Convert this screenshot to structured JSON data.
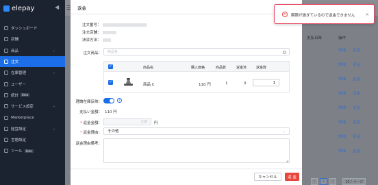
{
  "app": {
    "brand": "elepay"
  },
  "sidebar": {
    "items": [
      {
        "label": "ダッシュボード",
        "chevron": false,
        "active": false,
        "badge": ""
      },
      {
        "label": "店舗",
        "chevron": false,
        "active": false,
        "badge": ""
      },
      {
        "label": "商品",
        "chevron": true,
        "active": false,
        "badge": ""
      },
      {
        "label": "注文",
        "chevron": false,
        "active": true,
        "badge": ""
      },
      {
        "label": "在庫管理",
        "chevron": true,
        "active": false,
        "badge": ""
      },
      {
        "label": "ユーザー",
        "chevron": false,
        "active": false,
        "badge": ""
      },
      {
        "label": "統計",
        "chevron": false,
        "active": false,
        "badge": "Beta"
      },
      {
        "label": "サービス設定",
        "chevron": true,
        "active": false,
        "badge": ""
      },
      {
        "label": "Marketplace",
        "chevron": false,
        "active": false,
        "badge": ""
      },
      {
        "label": "経営設定",
        "chevron": true,
        "active": false,
        "badge": ""
      },
      {
        "label": "言語設定",
        "chevron": false,
        "active": false,
        "badge": ""
      },
      {
        "label": "ツール",
        "chevron": false,
        "active": false,
        "badge": "Beta"
      }
    ]
  },
  "background": {
    "columns": {
      "paid_at": "支払日時",
      "actions": "操作"
    },
    "rows": [
      {
        "detail": "詳細",
        "refund": "返金"
      },
      {
        "detail": "詳細",
        "refund": "返金"
      },
      {
        "detail": "詳細",
        "refund": "返金"
      },
      {
        "detail": "詳細",
        "refund": "返金"
      },
      {
        "detail": "詳細",
        "refund": "返金"
      },
      {
        "detail": "詳細",
        "refund": "返金"
      },
      {
        "detail": "詳細",
        "refund": "返金"
      },
      {
        "detail": "詳細",
        "refund": "返金"
      }
    ],
    "pager": {
      "current": "1",
      "per_page": "10 / ページ"
    }
  },
  "modal": {
    "title": "返金",
    "order_no_label": "注文番号：",
    "order_store_label": "注文店舗：",
    "payment_method_label": "決済方法：",
    "products_label": "注文商品：",
    "product_search_placeholder": "商品名",
    "table": {
      "headers": {
        "name": "商品名",
        "price": "購入価格",
        "count": "商品数",
        "refunded": "返金済",
        "refund_qty": "返金数"
      },
      "row": {
        "name": "商品 C",
        "price": "110 円",
        "count": "1",
        "refunded": "0",
        "refund_qty": "1"
      }
    },
    "restock_label": "理論在庫反映：",
    "paid_amount_label": "支払い金額：",
    "paid_amount_value": "110 円",
    "refund_amount_label": "返金金額：",
    "refund_amount_value": "110",
    "refund_amount_unit": "円",
    "refund_reason_label": "返金理由：",
    "refund_reason_value": "その他",
    "refund_note_label": "返金理由備考：",
    "cancel_label": "キャンセル",
    "submit_label": "返 金"
  },
  "toast": {
    "message": "期限が過ぎているので返金できません"
  },
  "colors": {
    "primary": "#1b6ee8",
    "danger": "#e8453c",
    "sidebar_bg": "#1c2330"
  }
}
